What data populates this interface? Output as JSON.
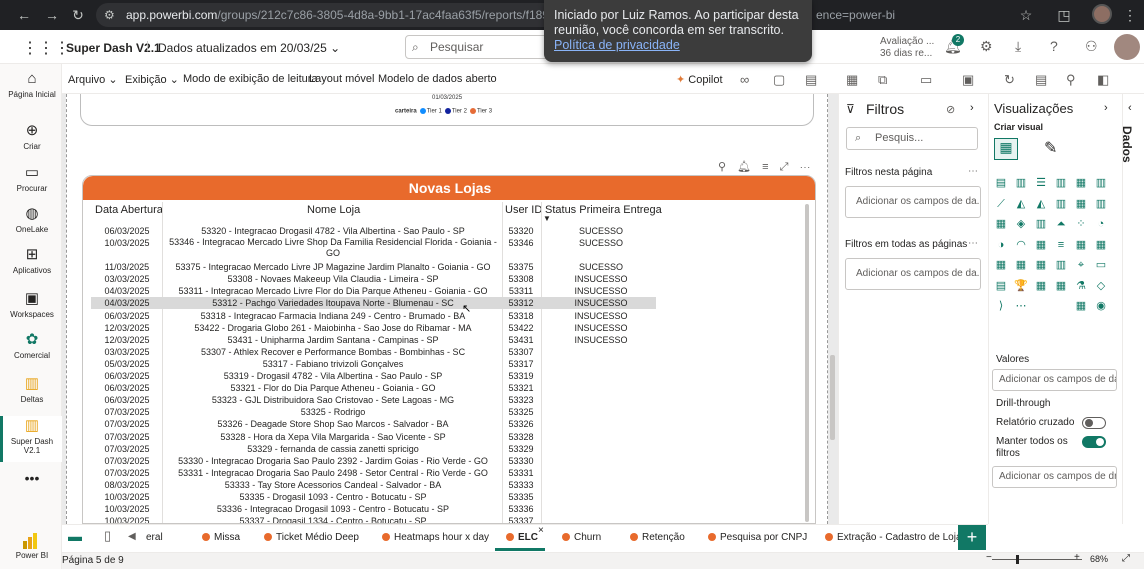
{
  "browser": {
    "url_host": "app.powerbi.com",
    "url_path": "/groups/212c7c86-3805-4d8a-9bb1-17ac4faa63f5/reports/f189eb33-2db6",
    "url_tail": "ence=power-bi"
  },
  "toast": {
    "text": "Iniciado por Luiz Ramos. Ao participar desta reunião, você concorda em ser transcrito.",
    "link": "Política de privacidade"
  },
  "app": {
    "report_name": "Super Dash V2.1",
    "updated": "Dados atualizados em 20/03/25",
    "search_placeholder": "Pesquisar",
    "eval_line1": "Avaliação ...",
    "eval_line2": "36 dias re...",
    "notif_count": "2"
  },
  "rail": [
    {
      "label": "Página Inicial",
      "icon": "home-icon"
    },
    {
      "label": "Criar",
      "icon": "plus-circle-icon"
    },
    {
      "label": "Procurar",
      "icon": "folder-icon"
    },
    {
      "label": "OneLake",
      "icon": "onelake-icon"
    },
    {
      "label": "Aplicativos",
      "icon": "apps-icon"
    },
    {
      "label": "Workspaces",
      "icon": "workspaces-icon"
    },
    {
      "label": "Comercial",
      "icon": "workspace-icon"
    },
    {
      "label": "Deltas",
      "icon": "report-icon"
    },
    {
      "label": "Super Dash V2.1",
      "icon": "report-icon"
    },
    {
      "label": "Power BI",
      "icon": "powerbi-logo"
    }
  ],
  "ribbon": {
    "arquivo": "Arquivo",
    "exibicao": "Exibição",
    "leitura": "Modo de exibição de leitura",
    "layout": "Layout móvel",
    "modelo": "Modelo de dados aberto",
    "copilot": "Copilot"
  },
  "prev_visual": {
    "date": "01/03/2025",
    "legend_title": "carteira",
    "legend": [
      "Tier 1",
      "Tier 2",
      "Tier 3"
    ],
    "colors": [
      "#118dff",
      "#12239e",
      "#e66c37"
    ]
  },
  "table": {
    "title": "Novas Lojas",
    "headers": [
      "Data Abertura",
      "Nome Loja",
      "User ID",
      "Status Primeira Entrega"
    ],
    "rows": [
      [
        "06/03/2025",
        "53320 - Integracao Drogasil 4782 - Vila Albertina - Sao Paulo - SP",
        "53320",
        "SUCESSO"
      ],
      [
        "10/03/2025",
        "53346 - Integracao Mercado Livre Shop Da Familia Residencial Florida - Goiania - GO",
        "53346",
        "SUCESSO"
      ],
      [
        "11/03/2025",
        "53375 - Integracao Mercado Livre JP Magazine Jardim Planalto - Goiania - GO",
        "53375",
        "SUCESSO"
      ],
      [
        "03/03/2025",
        "53308 - Novaes Makeeup Vila Claudia - Limeira - SP",
        "53308",
        "INSUCESSO"
      ],
      [
        "04/03/2025",
        "53311 - Integracao Mercado Livre Flor do Dia Parque Atheneu - Goiania - GO",
        "53311",
        "INSUCESSO"
      ],
      [
        "04/03/2025",
        "53312 - Pachgo Variedades Itoupava Norte - Blumenau - SC",
        "53312",
        "INSUCESSO"
      ],
      [
        "06/03/2025",
        "53318 - Integracao Farmacia Indiana 249 - Centro - Brumado - BA",
        "53318",
        "INSUCESSO"
      ],
      [
        "12/03/2025",
        "53422 - Drogaria Globo 261 - Maiobinha - Sao Jose do Ribamar - MA",
        "53422",
        "INSUCESSO"
      ],
      [
        "12/03/2025",
        "53431 - Unipharma Jardim Santana - Campinas - SP",
        "53431",
        "INSUCESSO"
      ],
      [
        "03/03/2025",
        "53307 - Athlex Recover e Performance Bombas - Bombinhas - SC",
        "53307",
        ""
      ],
      [
        "05/03/2025",
        "53317 - Fabiano trivizoli Gonçalves",
        "53317",
        ""
      ],
      [
        "06/03/2025",
        "53319 - Drogasil 4782 - Vila Albertina - Sao Paulo - SP",
        "53319",
        ""
      ],
      [
        "06/03/2025",
        "53321 - Flor do Dia Parque Atheneu - Goiania - GO",
        "53321",
        ""
      ],
      [
        "06/03/2025",
        "53323 - GJL Distribuidora Sao Cristovao - Sete Lagoas - MG",
        "53323",
        ""
      ],
      [
        "07/03/2025",
        "53325 - Rodrigo",
        "53325",
        ""
      ],
      [
        "07/03/2025",
        "53326 - Deagade Store Shop Sao Marcos - Salvador - BA",
        "53326",
        ""
      ],
      [
        "07/03/2025",
        "53328 - Hora da Xepa Vila Margarida - Sao Vicente - SP",
        "53328",
        ""
      ],
      [
        "07/03/2025",
        "53329 - fernanda de cassia zanetti spricigo",
        "53329",
        ""
      ],
      [
        "07/03/2025",
        "53330 - Integracao Drogaria Sao Paulo 2392 - Jardim Goias - Rio Verde - GO",
        "53330",
        ""
      ],
      [
        "07/03/2025",
        "53331 - Integracao Drogaria Sao Paulo 2498 - Setor Central - Rio Verde - GO",
        "53331",
        ""
      ],
      [
        "08/03/2025",
        "53333 - Tay Store Acessorios Candeal - Salvador - BA",
        "53333",
        ""
      ],
      [
        "10/03/2025",
        "53335 - Drogasil 1093 - Centro - Botucatu - SP",
        "53335",
        ""
      ],
      [
        "10/03/2025",
        "53336 - Integracao Drogasil 1093 - Centro - Botucatu - SP",
        "53336",
        ""
      ],
      [
        "10/03/2025",
        "53337 - Drogasil 1334 - Centro - Botucatu - SP",
        "53337",
        ""
      ]
    ]
  },
  "filters": {
    "title": "Filtros",
    "search": "Pesquis...",
    "on_page": "Filtros nesta página",
    "on_all": "Filtros em todas as páginas",
    "add": "Adicionar os campos de da..."
  },
  "viz": {
    "title": "Visualizações",
    "create": "Criar visual",
    "values": "Valores",
    "values_add": "Adicionar os campos de da...",
    "drill": "Drill-through",
    "cross": "Relatório cruzado",
    "keep": "Manter todos os filtros",
    "drill_add": "Adicionar os campos de dr...",
    "data": "Dados"
  },
  "tabs": [
    "eral",
    "Missa",
    "Ticket Médio Deep",
    "Heatmaps hour x day",
    "ELC",
    "Churn",
    "Retenção",
    "Pesquisa por CNPJ",
    "Extração - Cadastro de Loja"
  ],
  "status": {
    "page": "Página 5 de 9",
    "zoom": "68%"
  }
}
